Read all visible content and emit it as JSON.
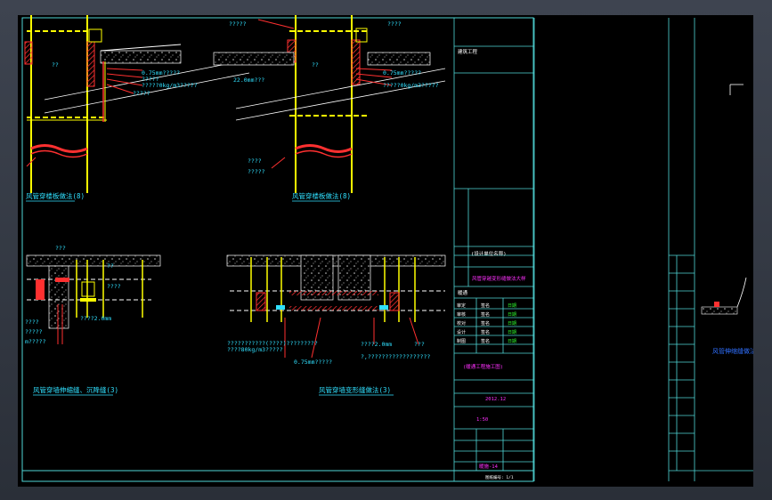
{
  "colors": {
    "background": "#000000",
    "viewport_bg": "#33373f",
    "frame": "#4fd6d6",
    "yellow": "#ffff00",
    "red": "#ff2020",
    "magenta": "#ff30ff",
    "green": "#30ff30",
    "white": "#ffffff",
    "cyan": "#30e0ff",
    "blue": "#3070ff"
  },
  "titles": {
    "view1": "风管穿楼板做法(8)",
    "view2": "风管穿楼板做法(8)",
    "view3": "风管穿墙伸缩缝、沉降缝(3)",
    "view4": "风管穿墙变形缝做法(3)",
    "right_title": "风管伸缩缝做法"
  },
  "labels": {
    "q5": "?????",
    "q4": "????",
    "q3": "???",
    "q2": "??",
    "thick075": "0.75mm?????",
    "density": "?????0kg/m3?????",
    "dim22": "22.0mm???",
    "dim20": "????2.0mm",
    "dim20b": "????2.0mm",
    "dim075b": "0.75mm?????",
    "note4": "???????????(????)?????????",
    "note4b": "????80kg/m3?????",
    "note4c": "?,??????????????????",
    "note3a": "????2.0mm",
    "note3b": "m?????"
  },
  "title_block": {
    "project": "建筑工程",
    "design_org": "(设计单位名称)",
    "drawing_name": "风管穿越变形缝做法大样",
    "section": "暖通",
    "discipline": "(暖通工程施工图)",
    "date_label": "2012.12",
    "scale": "1:50",
    "sheet_no": "暖施-14",
    "roles": [
      "审定",
      "审核",
      "校对",
      "设计",
      "制图"
    ],
    "signs": [
      "签名",
      "签名",
      "签名",
      "签名",
      "签名"
    ],
    "dates": [
      "日期",
      "日期",
      "日期",
      "日期",
      "日期"
    ],
    "footer": "图纸编号: 1/1"
  }
}
